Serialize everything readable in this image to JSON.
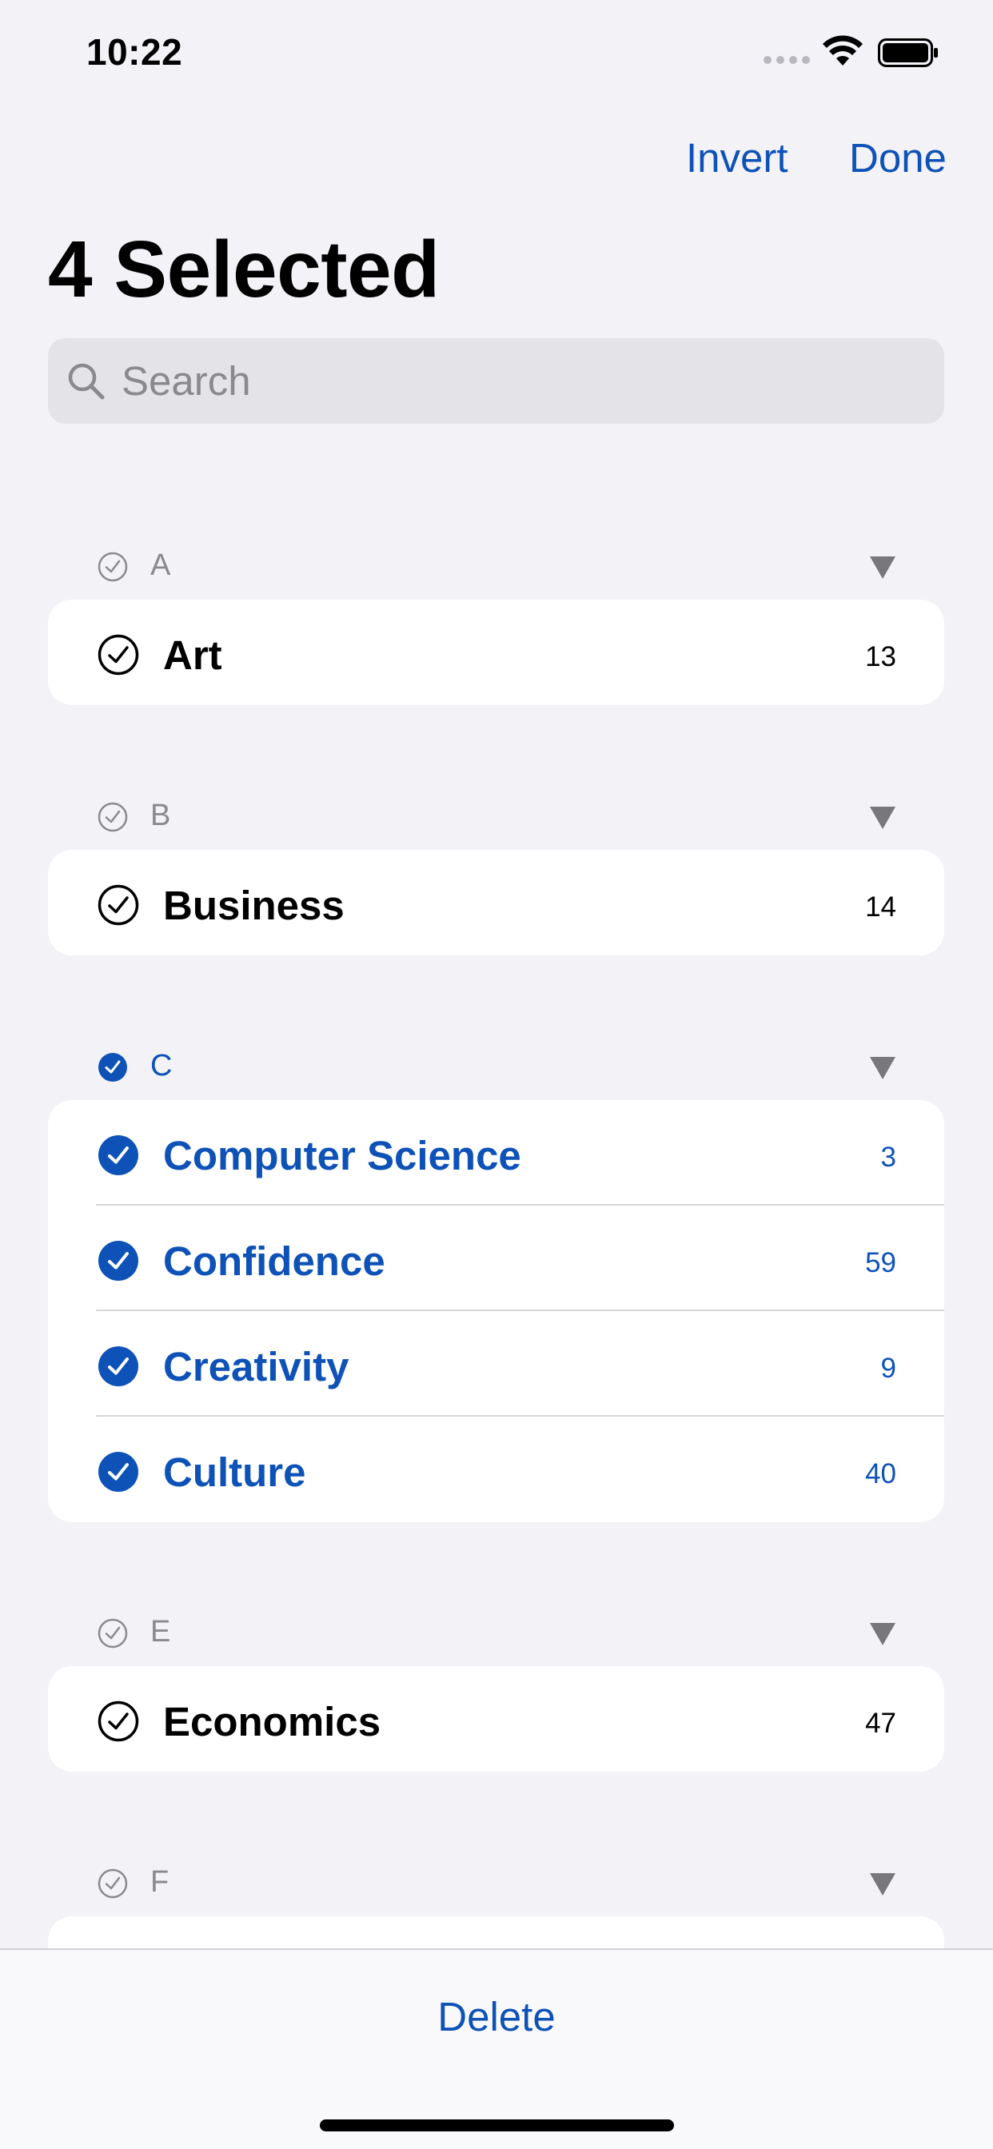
{
  "status_bar": {
    "time": "10:22"
  },
  "nav": {
    "invert_label": "Invert",
    "done_label": "Done"
  },
  "title": "4 Selected",
  "search": {
    "placeholder": "Search",
    "value": ""
  },
  "sections": [
    {
      "letter": "A",
      "selected": false,
      "items": [
        {
          "label": "Art",
          "count": "13",
          "selected": false
        }
      ]
    },
    {
      "letter": "B",
      "selected": false,
      "items": [
        {
          "label": "Business",
          "count": "14",
          "selected": false
        }
      ]
    },
    {
      "letter": "C",
      "selected": true,
      "items": [
        {
          "label": "Computer Science",
          "count": "3",
          "selected": true
        },
        {
          "label": "Confidence",
          "count": "59",
          "selected": true
        },
        {
          "label": "Creativity",
          "count": "9",
          "selected": true
        },
        {
          "label": "Culture",
          "count": "40",
          "selected": true
        }
      ]
    },
    {
      "letter": "E",
      "selected": false,
      "items": [
        {
          "label": "Economics",
          "count": "47",
          "selected": false
        }
      ]
    },
    {
      "letter": "F",
      "selected": false,
      "items": []
    }
  ],
  "toolbar": {
    "delete_label": "Delete"
  },
  "colors": {
    "accent": "#0E52B8",
    "background": "#F2F2F7",
    "card": "#FFFFFF",
    "muted": "#8A8A8E"
  },
  "icons": {
    "section_check": "circle-check-icon",
    "row_check": "circle-check-icon",
    "collapse": "triangle-down-icon",
    "search": "search-icon"
  }
}
